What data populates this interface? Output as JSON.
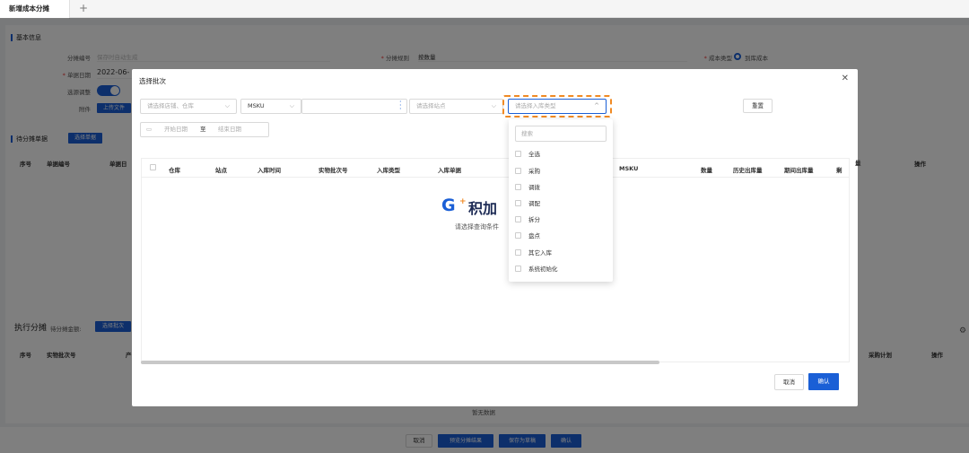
{
  "tabs": [
    {
      "label": "新增成本分摊"
    }
  ],
  "tab_add": "+",
  "page": {
    "basic_section": "基本信息",
    "fields": {
      "code_label": "分摊编号",
      "code_placeholder": "保存时自动生成",
      "date_label": "单据日期",
      "date_value": "2022-06-",
      "adjust_label": "选源调整",
      "attach_label": "附件",
      "upload_button": "上传文件",
      "rule_label": "分摊规则",
      "rule_value": "按数量",
      "cost_type_label": "成本类型",
      "cost_type_value": "到库成本"
    },
    "pending_section": "待分摊单据",
    "select_doc_button": "选择单据",
    "pending_table": {
      "headers": [
        "序号",
        "单据编号",
        "单据日"
      ]
    },
    "right_headers": [
      "操作"
    ],
    "exec_section": "执行分摊",
    "exec_sub": "待分摊金额:",
    "select_batch_button": "选择批次",
    "exec_table": {
      "headers": [
        "序号",
        "实物批次号",
        "产"
      ]
    },
    "exec_right_headers": [
      "采购计划",
      "操作"
    ],
    "no_data": "暂无数据",
    "settings_icon": "gear-icon"
  },
  "footer": {
    "cancel": "取消",
    "preview": "预览分摊结果",
    "save_draft": "保存为草稿",
    "confirm": "确认"
  },
  "modal": {
    "title": "选择批次",
    "filters": {
      "store_placeholder": "请选择店铺、仓库",
      "msku_label": "MSKU",
      "site_placeholder": "请选择站点",
      "type_placeholder": "请选择入库类型",
      "reset": "重置",
      "start_date": "开始日期",
      "date_sep": "至",
      "end_date": "结束日期"
    },
    "columns": [
      "仓库",
      "站点",
      "入库时间",
      "实物批次号",
      "入库类型",
      "入库单据",
      "MSKU",
      "数量",
      "历史出库量",
      "期间出库量",
      "剩"
    ],
    "right_col": "量",
    "empty": {
      "logo_g": "G",
      "logo_plus": "+",
      "logo_text": "积加",
      "hint": "请选择查询条件"
    },
    "cancel": "取消",
    "confirm": "确认"
  },
  "dropdown": {
    "search_placeholder": "搜索",
    "options": [
      "全选",
      "采购",
      "调拨",
      "调配",
      "拆分",
      "盘点",
      "其它入库",
      "系统初始化"
    ]
  }
}
